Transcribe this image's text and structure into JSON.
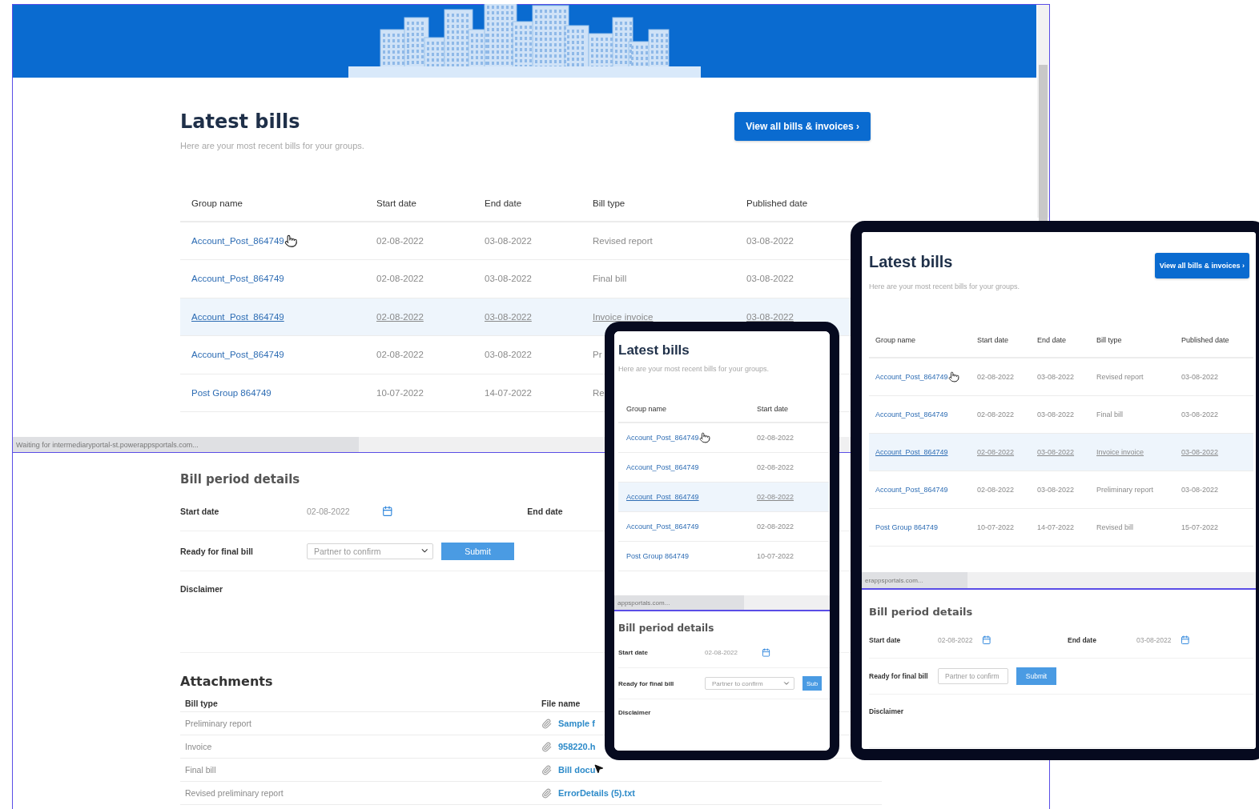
{
  "desktop": {
    "title": "Latest bills",
    "subtitle": "Here are your most recent bills for your groups.",
    "view_all_button": "View all bills & invoices ›",
    "table": {
      "columns": [
        "Group name",
        "Start date",
        "End date",
        "Bill type",
        "Published date"
      ],
      "rows": [
        {
          "cells": [
            "Account_Post_864749",
            "02-08-2022",
            "03-08-2022",
            "Revised report",
            "03-08-2022"
          ],
          "hovered": false,
          "pointer": true
        },
        {
          "cells": [
            "Account_Post_864749",
            "02-08-2022",
            "03-08-2022",
            "Final bill",
            "03-08-2022"
          ],
          "hovered": false,
          "pointer": false
        },
        {
          "cells": [
            "Account_Post_864749",
            "02-08-2022",
            "03-08-2022",
            "Invoice invoice",
            "03-08-2022"
          ],
          "hovered": true,
          "pointer": false
        },
        {
          "cells": [
            "Account_Post_864749",
            "02-08-2022",
            "03-08-2022",
            "Pr"
          ],
          "hovered": false,
          "pointer": false
        },
        {
          "cells": [
            "Post Group 864749",
            "10-07-2022",
            "14-07-2022",
            "Re"
          ],
          "hovered": false,
          "pointer": false
        }
      ]
    },
    "status_bar": "Waiting for intermediaryportal-st.powerappsportals.com...",
    "bill_period": {
      "title": "Bill period details",
      "start_label": "Start date",
      "start_value": "02-08-2022",
      "end_label": "End date",
      "ready_label": "Ready for final bill",
      "select_value": "Partner to confirm",
      "submit": "Submit",
      "disclaimer": "Disclaimer"
    },
    "attachments": {
      "title": "Attachments",
      "columns": [
        "Bill type",
        "File name"
      ],
      "rows": [
        {
          "bill_type": "Preliminary report",
          "file_name": "Sample f"
        },
        {
          "bill_type": "Invoice",
          "file_name": "958220.h"
        },
        {
          "bill_type": "Final bill",
          "file_name": "Bill docu"
        },
        {
          "bill_type": "Revised preliminary report",
          "file_name": "ErrorDetails (5).txt"
        }
      ]
    }
  },
  "phone": {
    "title": "Latest bills",
    "subtitle": "Here are your most recent bills for your groups.",
    "table": {
      "columns": [
        "Group name",
        "Start date"
      ],
      "rows": [
        {
          "cells": [
            "Account_Post_864749",
            "02-08-2022"
          ],
          "hovered": false,
          "pointer": true
        },
        {
          "cells": [
            "Account_Post_864749",
            "02-08-2022"
          ],
          "hovered": false,
          "pointer": false
        },
        {
          "cells": [
            "Account_Post_864749",
            "02-08-2022"
          ],
          "hovered": true,
          "pointer": false
        },
        {
          "cells": [
            "Account_Post_864749",
            "02-08-2022"
          ],
          "hovered": false,
          "pointer": false
        },
        {
          "cells": [
            "Post Group 864749",
            "10-07-2022"
          ],
          "hovered": false,
          "pointer": false
        }
      ]
    },
    "status_bar": "appsportals.com...",
    "bill_period": {
      "title": "Bill period details",
      "start_label": "Start date",
      "start_value": "02-08-2022",
      "ready_label": "Ready for final bill",
      "select_value": "Partner to confirm",
      "submit": "Sub",
      "disclaimer": "Disclaimer"
    }
  },
  "tablet": {
    "title": "Latest bills",
    "subtitle": "Here are your most recent bills for your groups.",
    "view_all_button": "View all bills & invoices ›",
    "table": {
      "columns": [
        "Group name",
        "Start date",
        "End date",
        "Bill type",
        "Published date"
      ],
      "rows": [
        {
          "cells": [
            "Account_Post_864749",
            "02-08-2022",
            "03-08-2022",
            "Revised report",
            "03-08-2022"
          ],
          "hovered": false,
          "pointer": true
        },
        {
          "cells": [
            "Account_Post_864749",
            "02-08-2022",
            "03-08-2022",
            "Final bill",
            "03-08-2022"
          ],
          "hovered": false,
          "pointer": false
        },
        {
          "cells": [
            "Account_Post_864749",
            "02-08-2022",
            "03-08-2022",
            "Invoice invoice",
            "03-08-2022"
          ],
          "hovered": true,
          "pointer": false
        },
        {
          "cells": [
            "Account_Post_864749",
            "02-08-2022",
            "03-08-2022",
            "Preliminary report",
            "03-08-2022"
          ],
          "hovered": false,
          "pointer": false
        },
        {
          "cells": [
            "Post Group 864749",
            "10-07-2022",
            "14-07-2022",
            "Revised bill",
            "15-07-2022"
          ],
          "hovered": false,
          "pointer": false
        }
      ]
    },
    "status_bar": "erappsportals.com...",
    "bill_period": {
      "title": "Bill period details",
      "start_label": "Start date",
      "start_value": "02-08-2022",
      "end_label": "End date",
      "end_value": "03-08-2022",
      "ready_label": "Ready for final bill",
      "select_value": "Partner to confirm",
      "submit": "Submit",
      "disclaimer": "Disclaimer"
    }
  }
}
